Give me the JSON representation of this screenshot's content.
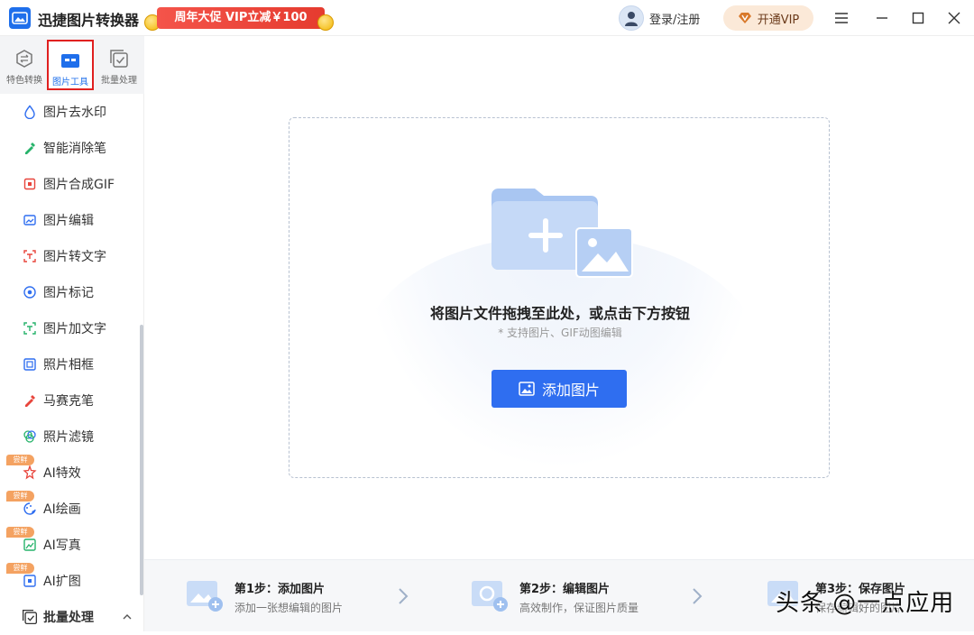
{
  "app": {
    "title": "迅捷图片转换器"
  },
  "promo": {
    "text": "周年大促 VIP立减￥100"
  },
  "header": {
    "login_label": "登录/注册",
    "vip_label": "开通VIP"
  },
  "sidebar": {
    "tabs": [
      {
        "label": "特色转换",
        "icon": "convert-icon"
      },
      {
        "label": "图片工具",
        "icon": "toolbox-icon",
        "active": true
      },
      {
        "label": "批量处理",
        "icon": "batch-icon"
      }
    ],
    "items": [
      {
        "label": "图片去水印",
        "icon": "droplet-icon"
      },
      {
        "label": "智能消除笔",
        "icon": "eraser-pen-icon"
      },
      {
        "label": "图片合成GIF",
        "icon": "gif-icon"
      },
      {
        "label": "图片编辑",
        "icon": "edit-image-icon"
      },
      {
        "label": "图片转文字",
        "icon": "scan-text-icon"
      },
      {
        "label": "图片标记",
        "icon": "marker-icon"
      },
      {
        "label": "图片加文字",
        "icon": "add-text-icon"
      },
      {
        "label": "照片相框",
        "icon": "frame-icon"
      },
      {
        "label": "马赛克笔",
        "icon": "mosaic-pen-icon"
      },
      {
        "label": "照片滤镜",
        "icon": "filter-icon"
      },
      {
        "label": "AI特效",
        "icon": "ai-effect-icon",
        "badge": "尝鲜"
      },
      {
        "label": "AI绘画",
        "icon": "ai-paint-icon",
        "badge": "尝鲜"
      },
      {
        "label": "AI写真",
        "icon": "ai-portrait-icon",
        "badge": "尝鲜"
      },
      {
        "label": "AI扩图",
        "icon": "ai-expand-icon",
        "badge": "尝鲜"
      }
    ],
    "section": {
      "label": "批量处理",
      "icon": "batch-icon",
      "chevron": "chevron-up-icon"
    }
  },
  "dropzone": {
    "title": "将图片文件拖拽至此处，或点击下方按钮",
    "subtitle": "* 支持图片、GIF动图编辑",
    "button_label": "添加图片"
  },
  "steps": [
    {
      "title": "第1步：添加图片",
      "desc": "添加一张想编辑的图片"
    },
    {
      "title": "第2步：编辑图片",
      "desc": "高效制作，保证图片质量"
    },
    {
      "title": "第3步：保存图片",
      "desc": "保存编辑好的图片"
    }
  ],
  "watermark": {
    "text": "头条 @一点应用"
  },
  "colors": {
    "accent": "#2f6ef0",
    "promo": "#e53b2f",
    "vip_bg": "#fbe9d8",
    "badge": "#f4a261"
  }
}
